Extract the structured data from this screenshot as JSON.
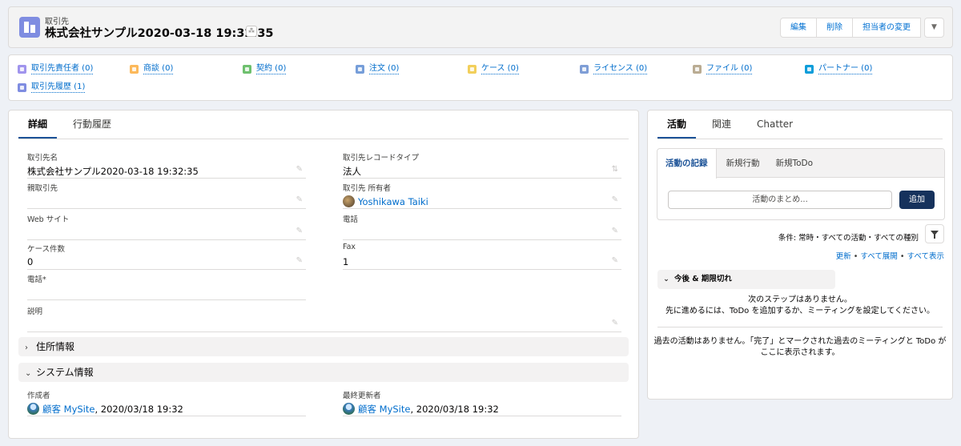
{
  "header": {
    "object_type": "取引先",
    "title": "株式会社サンプル2020-03-18 19:32:35",
    "buttons": [
      "編集",
      "削除",
      "担当者の変更"
    ],
    "hierarchy_glyph": "⁂",
    "dropdown_glyph": "▼"
  },
  "related": [
    {
      "label": "取引先責任者 (0)",
      "icon": "contact-icon",
      "color": "#a094ed"
    },
    {
      "label": "商談 (0)",
      "icon": "opportunity-icon",
      "color": "#fcb95b"
    },
    {
      "label": "契約 (0)",
      "icon": "contract-icon",
      "color": "#6ec06e"
    },
    {
      "label": "注文 (0)",
      "icon": "order-icon",
      "color": "#769ed9"
    },
    {
      "label": "ケース (0)",
      "icon": "case-icon",
      "color": "#f2cf5b"
    },
    {
      "label": "ライセンス (0)",
      "icon": "license-icon",
      "color": "#7f9ed6"
    },
    {
      "label": "ファイル (0)",
      "icon": "file-icon",
      "color": "#baac93"
    },
    {
      "label": "パートナー (0)",
      "icon": "partner-icon",
      "color": "#0d9dda"
    },
    {
      "label": "取引先履歴 (1)",
      "icon": "history-icon",
      "color": "#7f8de1"
    }
  ],
  "detail": {
    "tabs": [
      "詳細",
      "行動履歴"
    ],
    "fields": {
      "account_name": {
        "label": "取引先名",
        "value": "株式会社サンプル2020-03-18 19:32:35"
      },
      "record_type": {
        "label": "取引先レコードタイプ",
        "value": "法人"
      },
      "parent": {
        "label": "親取引先",
        "value": ""
      },
      "owner": {
        "label": "取引先 所有者",
        "value": "Yoshikawa Taiki"
      },
      "website": {
        "label": "Web サイト",
        "value": ""
      },
      "phone": {
        "label": "電話",
        "value": ""
      },
      "case_count": {
        "label": "ケース件数",
        "value": "0"
      },
      "fax": {
        "label": "Fax",
        "value": "1"
      },
      "phone_req": {
        "label": "電話*",
        "value": ""
      },
      "description": {
        "label": "説明",
        "value": ""
      },
      "created_by": {
        "label": "作成者",
        "user": "顧客 MySite",
        "date": ", 2020/03/18 19:32"
      },
      "modified_by": {
        "label": "最終更新者",
        "user": "顧客 MySite",
        "date": ", 2020/03/18 19:32"
      }
    },
    "sections": {
      "address": {
        "label": "住所情報",
        "chevron": "›"
      },
      "system": {
        "label": "システム情報",
        "chevron": "⌄"
      }
    }
  },
  "activity": {
    "tabs": [
      "活動",
      "関連",
      "Chatter"
    ],
    "subtabs": [
      "活動の記録",
      "新規行動",
      "新規ToDo"
    ],
    "summary_placeholder": "活動のまとめ...",
    "add_label": "追加",
    "filter_text": "条件: 常時・すべての活動・すべての種別",
    "links": {
      "refresh": "更新",
      "sep": " • ",
      "expand": "すべて展開",
      "show_all": "すべて表示"
    },
    "upcoming_label": "今後 & 期限切れ",
    "no_steps_1": "次のステップはありません。",
    "no_steps_2": "先に進めるには、ToDo を追加するか、ミーティングを設定してください。",
    "no_past_1": "過去の活動はありません。「完了」とマークされた過去のミーティングと ToDo が",
    "no_past_2": "ここに表示されます。"
  }
}
